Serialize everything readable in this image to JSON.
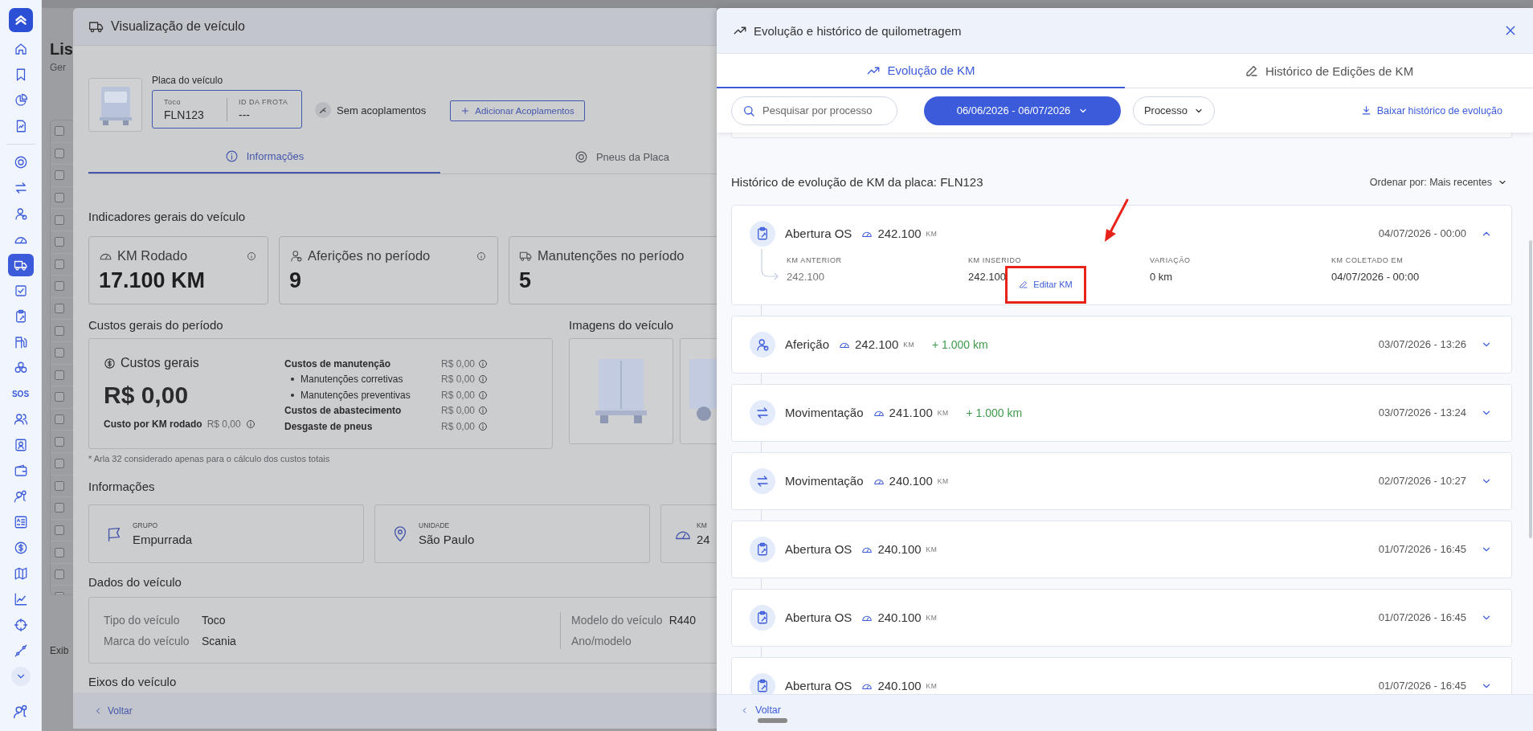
{
  "sidebar": {
    "items": [
      {
        "selected": false
      },
      {
        "selected": false
      },
      {
        "selected": false
      },
      {
        "selected": false
      },
      {
        "selected": false
      },
      {
        "selected": false
      },
      {
        "selected": false
      },
      {
        "selected": false
      },
      {
        "selected": true
      },
      {
        "selected": false
      },
      {
        "selected": false
      },
      {
        "selected": false
      },
      {
        "selected": false
      },
      {
        "label": "SOS",
        "selected": false
      },
      {
        "selected": false
      },
      {
        "selected": false
      },
      {
        "selected": false
      },
      {
        "selected": false
      },
      {
        "selected": false
      },
      {
        "selected": false
      },
      {
        "selected": false
      },
      {
        "selected": false
      },
      {
        "selected": false
      },
      {
        "selected": false
      }
    ]
  },
  "background": {
    "title": "Lis",
    "subtitle": "Ger",
    "rows": [
      {
        "checked": false
      },
      {
        "checked": false
      },
      {
        "checked": false
      },
      {
        "checked": false
      },
      {
        "checked": false
      },
      {
        "checked": false
      },
      {
        "checked": false
      },
      {
        "checked": false
      },
      {
        "checked": false
      },
      {
        "checked": false
      },
      {
        "checked": false
      },
      {
        "checked": false
      },
      {
        "checked": false
      },
      {
        "checked": false
      },
      {
        "checked": false
      },
      {
        "checked": false
      },
      {
        "checked": false
      },
      {
        "checked": false
      },
      {
        "checked": false
      },
      {
        "checked": false
      },
      {
        "checked": false
      },
      {
        "checked": false
      }
    ],
    "footer": "Exib"
  },
  "vehicle_modal": {
    "title": "Visualização de veículo",
    "plate_label": "Placa do veículo",
    "plate": {
      "type_label": "Toco",
      "plate": "FLN123",
      "fleet_id_label": "ID DA FROTA",
      "fleet_id": "---"
    },
    "couplings": "Sem acoplamentos",
    "add_button": "Adicionar Acoplamentos",
    "tabs": [
      {
        "label": "Informações",
        "selected": true
      },
      {
        "label": "Pneus da Placa",
        "selected": false
      }
    ],
    "indicators_title": "Indicadores gerais do veículo",
    "indicators": [
      {
        "label": "KM Rodado",
        "value": "17.100 KM",
        "info": true
      },
      {
        "label": "Aferições no período",
        "value": "9",
        "info": true
      },
      {
        "label": "Manutenções no período",
        "value": "5",
        "info": false
      }
    ],
    "costs": {
      "title": "Custos gerais do período",
      "heading": "Custos gerais",
      "total": "R$ 0,00",
      "per_km_label": "Custo por KM rodado",
      "per_km_value": "R$ 0,00",
      "lines": [
        {
          "kind": "main",
          "label": "Custos de manutenção",
          "value": "R$ 0,00"
        },
        {
          "kind": "sub",
          "label": "Manutenções corretivas",
          "value": "R$ 0,00"
        },
        {
          "kind": "sub",
          "label": "Manutenções preventivas",
          "value": "R$ 0,00"
        },
        {
          "kind": "main",
          "label": "Custos de abastecimento",
          "value": "R$ 0,00"
        },
        {
          "kind": "main",
          "label": "Desgaste de pneus",
          "value": "R$ 0,00"
        }
      ],
      "footnote": "*  Arla 32 considerado apenas para o cálculo dos custos totais"
    },
    "images": {
      "title": "Imagens do veículo",
      "items": [
        {
          "kind": "rear"
        },
        {
          "kind": "side"
        }
      ]
    },
    "info_title": "Informações",
    "info_cards": [
      {
        "label": "GRUPO",
        "value": "Empurrada"
      },
      {
        "label": "UNIDADE",
        "value": "São Paulo"
      },
      {
        "label": "KM",
        "value": "24"
      }
    ],
    "data_title": "Dados do veículo",
    "data_left": [
      {
        "label": "Tipo do veículo",
        "value": "Toco"
      },
      {
        "label": "Marca do veículo",
        "value": "Scania"
      }
    ],
    "data_right": [
      {
        "label": "Modelo do veículo",
        "value": "R440"
      },
      {
        "label": "Ano/modelo"
      }
    ],
    "axles_title": "Eixos do veículo",
    "back": "Voltar"
  },
  "drawer": {
    "title": "Evolução e histórico de quilometragem",
    "tabs": [
      {
        "label": "Evolução de KM",
        "selected": true
      },
      {
        "label": "Histórico de Edições de KM",
        "selected": false
      }
    ],
    "search": {
      "placeholder": "Pesquisar por processo"
    },
    "date_range": "06/06/2026 - 06/07/2026",
    "process_filter": "Processo",
    "download": "Baixar histórico de evolução",
    "history_title": "Histórico de evolução de KM da placa: FLN123",
    "sort": "Ordenar por: Mais recentes",
    "entries": [
      {
        "kind": "os",
        "title": "Abertura OS",
        "km": "242.100",
        "unit": "KM",
        "date": "04/07/2026 - 00:00",
        "expanded": true,
        "details": [
          {
            "label": "KM ANTERIOR",
            "value": "242.100"
          },
          {
            "label": "KM INSERIDO",
            "value": "242.100"
          },
          {
            "label": "VARIAÇÃO",
            "value": "0 km"
          },
          {
            "label": "KM COLETADO EM",
            "value": "04/07/2026 - 00:00"
          }
        ],
        "edit": "Editar KM"
      },
      {
        "kind": "measure",
        "title": "Aferição",
        "km": "242.100",
        "unit": "KM",
        "delta": "+ 1.000 km",
        "date": "03/07/2026 - 13:26",
        "expanded": false
      },
      {
        "kind": "move",
        "title": "Movimentação",
        "km": "241.100",
        "unit": "KM",
        "delta": "+ 1.000 km",
        "date": "03/07/2026 - 13:24",
        "expanded": false
      },
      {
        "kind": "move",
        "title": "Movimentação",
        "km": "240.100",
        "unit": "KM",
        "date": "02/07/2026 - 10:27",
        "expanded": false
      },
      {
        "kind": "os",
        "title": "Abertura OS",
        "km": "240.100",
        "unit": "KM",
        "date": "01/07/2026 - 16:45",
        "expanded": false
      },
      {
        "kind": "os",
        "title": "Abertura OS",
        "km": "240.100",
        "unit": "KM",
        "date": "01/07/2026 - 16:45",
        "expanded": false
      },
      {
        "kind": "os",
        "title": "Abertura OS",
        "km": "240.100",
        "unit": "KM",
        "date": "01/07/2026 - 16:45",
        "expanded": false
      }
    ],
    "back": "Voltar"
  }
}
